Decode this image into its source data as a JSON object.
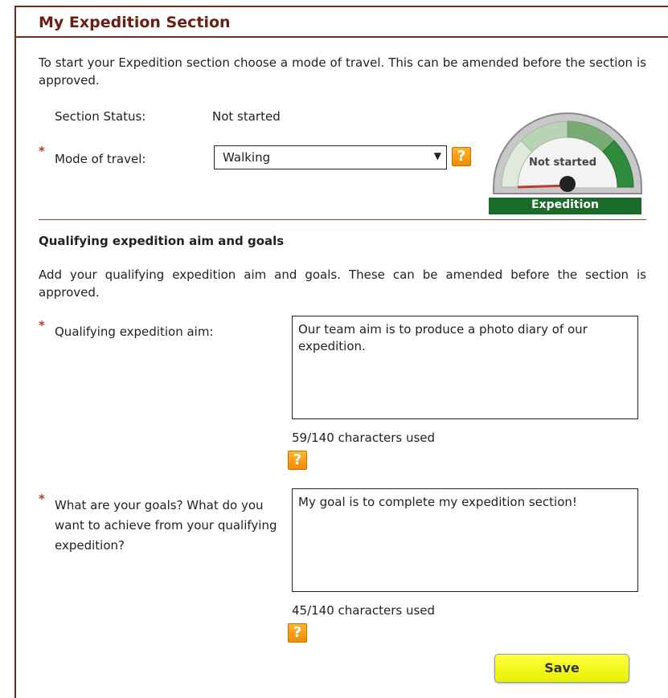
{
  "header": {
    "title": "My Expedition Section"
  },
  "intro": {
    "text": "To start your Expedition section choose a mode of travel. This can be amended before the section is approved."
  },
  "status": {
    "label": "Section Status:",
    "value": "Not started"
  },
  "mode": {
    "label": "Mode of travel:",
    "selected": "Walking",
    "required_mark": "*"
  },
  "gauge": {
    "status_text": "Not started",
    "banner": "Expedition",
    "progress": 0,
    "colors": {
      "banner": "#1a6b2a",
      "accent": "#2e8b3d"
    }
  },
  "aims_section": {
    "heading": "Qualifying expedition aim and goals",
    "description": "Add your qualifying expedition aim and goals. These can be amended before the section is approved.",
    "aim": {
      "label": "Qualifying expedition aim:",
      "value": "Our team aim is to produce a photo diary of our expedition.",
      "counter": "59/140 characters used"
    },
    "goals": {
      "label": "What are your goals? What do you want to achieve from your qualifying expedition?",
      "value": "My goal is to complete my expedition section!",
      "counter": "45/140 characters used"
    }
  },
  "help_glyph": "?",
  "actions": {
    "save_label": "Save"
  }
}
